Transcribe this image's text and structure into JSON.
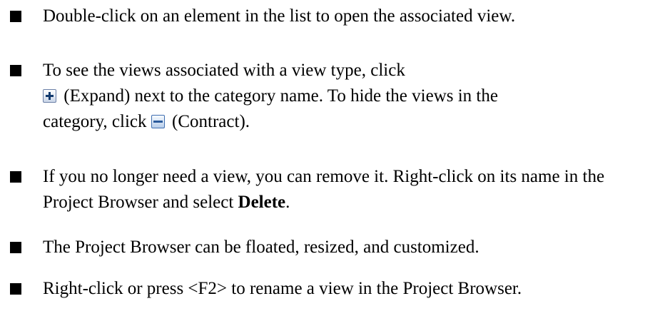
{
  "items": [
    {
      "text": "Double-click on an element in the list to open the associated view."
    },
    {
      "line1": "To see the views associated with a view type, click",
      "expand_text": " (Expand) next to the category name. To hide the views in the",
      "line3_start": "category, click ",
      "contract_text": " (Contract)."
    },
    {
      "text_start": "If you no longer need a view, you can remove it. Right-click on its name in the Project Browser and select ",
      "bold": "Delete",
      "text_end": "."
    },
    {
      "text": "The Project Browser can be floated, resized, and customized."
    },
    {
      "text": "Right-click or press <F2> to rename a view in the Project Browser."
    }
  ],
  "icons": [
    "expand-icon",
    "contract-icon"
  ]
}
